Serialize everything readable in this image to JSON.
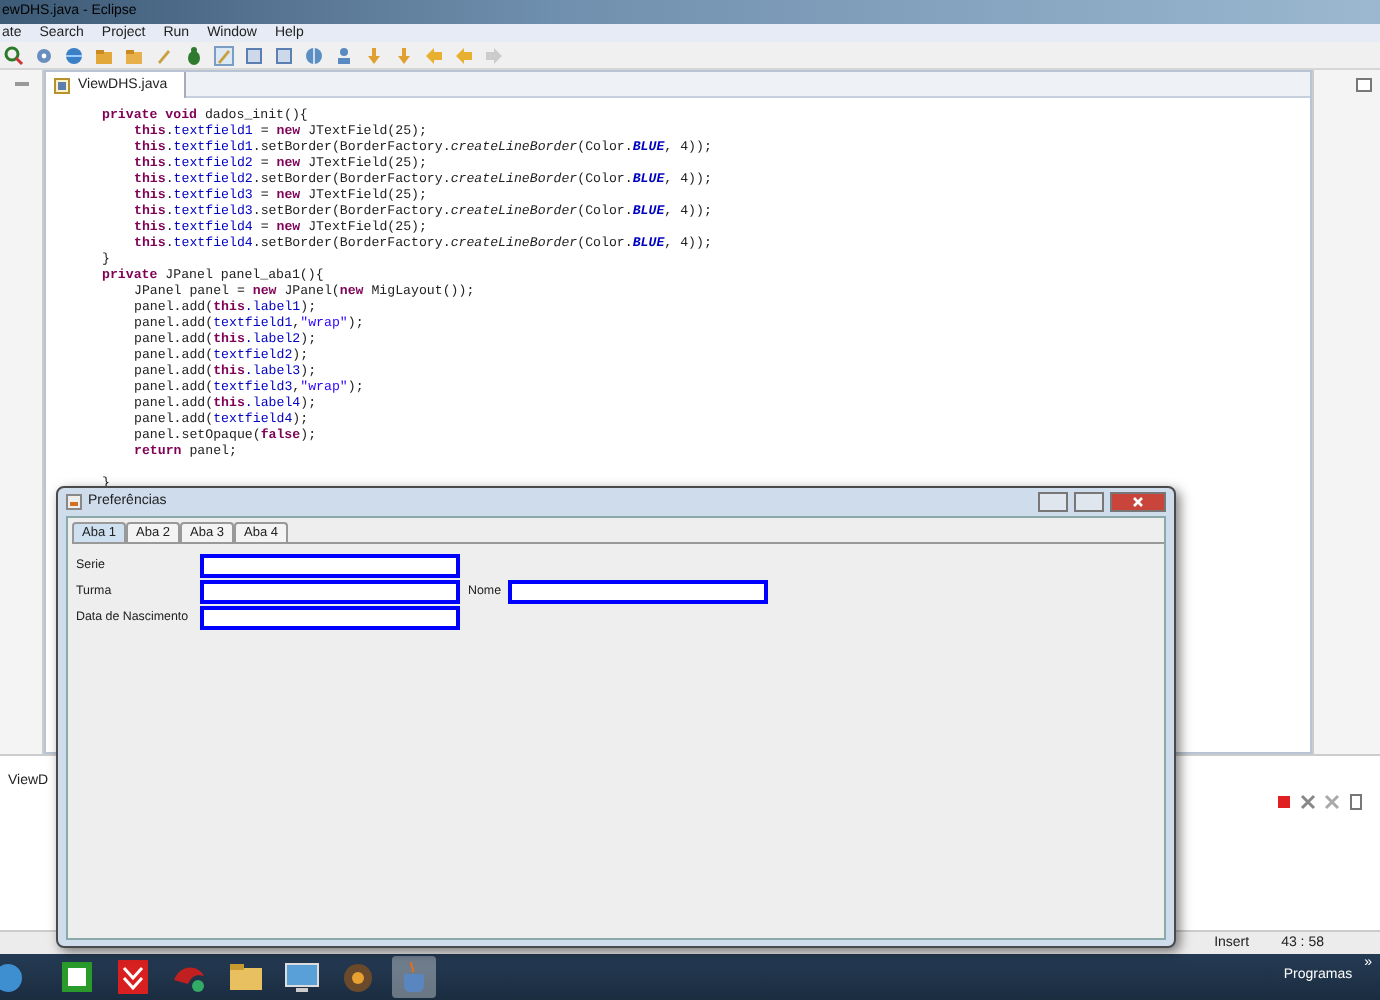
{
  "window": {
    "title": "ewDHS.java - Eclipse"
  },
  "menu": [
    "ate",
    "Search",
    "Project",
    "Run",
    "Window",
    "Help"
  ],
  "editor": {
    "tab": {
      "label": "ViewDHS.java",
      "selected": true
    },
    "lines": [
      {
        "kind": "decl",
        "tokens": [
          {
            "text": "private void",
            "kind": "keyword"
          },
          {
            "text": " dados_init(){",
            "kind": "plain"
          }
        ]
      },
      {
        "kind": "body",
        "tokens": [
          {
            "text": "this",
            "kind": "keyword"
          },
          {
            "text": ".",
            "kind": "plain"
          },
          {
            "text": "textfield1",
            "kind": "field"
          },
          {
            "text": " = ",
            "kind": "plain"
          },
          {
            "text": "new",
            "kind": "keyword"
          },
          {
            "text": " JTextField(25);",
            "kind": "plain"
          }
        ]
      },
      {
        "kind": "body",
        "tokens": [
          {
            "text": "this",
            "kind": "keyword"
          },
          {
            "text": ".",
            "kind": "plain"
          },
          {
            "text": "textfield1",
            "kind": "field"
          },
          {
            "text": ".setBorder(BorderFactory.",
            "kind": "plain"
          },
          {
            "text": "createLineBorder",
            "kind": "static"
          },
          {
            "text": "(Color.",
            "kind": "plain"
          },
          {
            "text": "BLUE",
            "kind": "constant"
          },
          {
            "text": ", 4));",
            "kind": "plain"
          }
        ]
      },
      {
        "kind": "body",
        "tokens": [
          {
            "text": "this",
            "kind": "keyword"
          },
          {
            "text": ".",
            "kind": "plain"
          },
          {
            "text": "textfield2",
            "kind": "field"
          },
          {
            "text": " = ",
            "kind": "plain"
          },
          {
            "text": "new",
            "kind": "keyword"
          },
          {
            "text": " JTextField(25);",
            "kind": "plain"
          }
        ]
      },
      {
        "kind": "body",
        "tokens": [
          {
            "text": "this",
            "kind": "keyword"
          },
          {
            "text": ".",
            "kind": "plain"
          },
          {
            "text": "textfield2",
            "kind": "field"
          },
          {
            "text": ".setBorder(BorderFactory.",
            "kind": "plain"
          },
          {
            "text": "createLineBorder",
            "kind": "static"
          },
          {
            "text": "(Color.",
            "kind": "plain"
          },
          {
            "text": "BLUE",
            "kind": "constant"
          },
          {
            "text": ", 4));",
            "kind": "plain"
          }
        ]
      },
      {
        "kind": "body",
        "tokens": [
          {
            "text": "this",
            "kind": "keyword"
          },
          {
            "text": ".",
            "kind": "plain"
          },
          {
            "text": "textfield3",
            "kind": "field"
          },
          {
            "text": " = ",
            "kind": "plain"
          },
          {
            "text": "new",
            "kind": "keyword"
          },
          {
            "text": " JTextField(25);",
            "kind": "plain"
          }
        ]
      },
      {
        "kind": "body",
        "tokens": [
          {
            "text": "this",
            "kind": "keyword"
          },
          {
            "text": ".",
            "kind": "plain"
          },
          {
            "text": "textfield3",
            "kind": "field"
          },
          {
            "text": ".setBorder(BorderFactory.",
            "kind": "plain"
          },
          {
            "text": "createLineBorder",
            "kind": "static"
          },
          {
            "text": "(Color.",
            "kind": "plain"
          },
          {
            "text": "BLUE",
            "kind": "constant"
          },
          {
            "text": ", 4));",
            "kind": "plain"
          }
        ]
      },
      {
        "kind": "body",
        "tokens": [
          {
            "text": "this",
            "kind": "keyword"
          },
          {
            "text": ".",
            "kind": "plain"
          },
          {
            "text": "textfield4",
            "kind": "field"
          },
          {
            "text": " = ",
            "kind": "plain"
          },
          {
            "text": "new",
            "kind": "keyword"
          },
          {
            "text": " JTextField(25);",
            "kind": "plain"
          }
        ]
      },
      {
        "kind": "body",
        "tokens": [
          {
            "text": "this",
            "kind": "keyword"
          },
          {
            "text": ".",
            "kind": "plain"
          },
          {
            "text": "textfield4",
            "kind": "field"
          },
          {
            "text": ".setBorder(BorderFactory.",
            "kind": "plain"
          },
          {
            "text": "createLineBorder",
            "kind": "static"
          },
          {
            "text": "(Color.",
            "kind": "plain"
          },
          {
            "text": "BLUE",
            "kind": "constant"
          },
          {
            "text": ", 4));",
            "kind": "plain"
          }
        ]
      },
      {
        "kind": "close",
        "tokens": [
          {
            "text": "}",
            "kind": "plain"
          }
        ]
      },
      {
        "kind": "decl",
        "tokens": [
          {
            "text": "private",
            "kind": "keyword"
          },
          {
            "text": " JPanel panel_aba1(){",
            "kind": "plain"
          }
        ]
      },
      {
        "kind": "body",
        "tokens": [
          {
            "text": "JPanel panel = ",
            "kind": "plain"
          },
          {
            "text": "new",
            "kind": "keyword"
          },
          {
            "text": " JPanel(",
            "kind": "plain"
          },
          {
            "text": "new",
            "kind": "keyword"
          },
          {
            "text": " MigLayout());",
            "kind": "plain"
          }
        ]
      },
      {
        "kind": "body",
        "tokens": [
          {
            "text": "panel.add(",
            "kind": "plain"
          },
          {
            "text": "this",
            "kind": "keyword"
          },
          {
            "text": ".label1",
            "kind": "field"
          },
          {
            "text": ");",
            "kind": "plain"
          }
        ]
      },
      {
        "kind": "body",
        "tokens": [
          {
            "text": "panel.add(",
            "kind": "plain"
          },
          {
            "text": "textfield1",
            "kind": "field"
          },
          {
            "text": ",",
            "kind": "plain"
          },
          {
            "text": "\"wrap\"",
            "kind": "string"
          },
          {
            "text": ");",
            "kind": "plain"
          }
        ]
      },
      {
        "kind": "body",
        "tokens": [
          {
            "text": "panel.add(",
            "kind": "plain"
          },
          {
            "text": "this",
            "kind": "keyword"
          },
          {
            "text": ".label2",
            "kind": "field"
          },
          {
            "text": ");",
            "kind": "plain"
          }
        ]
      },
      {
        "kind": "body",
        "tokens": [
          {
            "text": "panel.add(",
            "kind": "plain"
          },
          {
            "text": "textfield2",
            "kind": "field"
          },
          {
            "text": ");",
            "kind": "plain"
          }
        ]
      },
      {
        "kind": "body",
        "tokens": [
          {
            "text": "panel.add(",
            "kind": "plain"
          },
          {
            "text": "this",
            "kind": "keyword"
          },
          {
            "text": ".label3",
            "kind": "field"
          },
          {
            "text": ");",
            "kind": "plain"
          }
        ]
      },
      {
        "kind": "body",
        "tokens": [
          {
            "text": "panel.add(",
            "kind": "plain"
          },
          {
            "text": "textfield3",
            "kind": "field"
          },
          {
            "text": ",",
            "kind": "plain"
          },
          {
            "text": "\"wrap\"",
            "kind": "string"
          },
          {
            "text": ");",
            "kind": "plain"
          }
        ]
      },
      {
        "kind": "body",
        "tokens": [
          {
            "text": "panel.add(",
            "kind": "plain"
          },
          {
            "text": "this",
            "kind": "keyword"
          },
          {
            "text": ".label4",
            "kind": "field"
          },
          {
            "text": ");",
            "kind": "plain"
          }
        ]
      },
      {
        "kind": "body",
        "tokens": [
          {
            "text": "panel.add(",
            "kind": "plain"
          },
          {
            "text": "textfield4",
            "kind": "field"
          },
          {
            "text": ");",
            "kind": "plain"
          }
        ]
      },
      {
        "kind": "body",
        "tokens": [
          {
            "text": "panel.setOpaque(",
            "kind": "plain"
          },
          {
            "text": "false",
            "kind": "keyword"
          },
          {
            "text": ");",
            "kind": "plain"
          }
        ]
      },
      {
        "kind": "body",
        "tokens": [
          {
            "text": "return",
            "kind": "keyword"
          },
          {
            "text": " panel;",
            "kind": "plain"
          }
        ]
      },
      {
        "kind": "gap",
        "tokens": [
          {
            "text": "}",
            "kind": "plain"
          }
        ]
      }
    ]
  },
  "bottom_panel": {
    "tab": "ViewD"
  },
  "status_bar": {
    "insert_mode": "Insert",
    "position": "43 : 58"
  },
  "dialog": {
    "title": "Preferências",
    "tabs": [
      {
        "label": "Aba 1",
        "selected": true
      },
      {
        "label": "Aba 2",
        "selected": false
      },
      {
        "label": "Aba 3",
        "selected": false
      },
      {
        "label": "Aba 4",
        "selected": false
      }
    ],
    "rows": [
      {
        "fields": [
          {
            "label": "Serie"
          }
        ]
      },
      {
        "fields": [
          {
            "label": "Turma"
          },
          {
            "label": "Nome"
          }
        ]
      },
      {
        "fields": [
          {
            "label": "Data de Nascimento"
          }
        ]
      }
    ]
  },
  "taskbar": {
    "toolbar_label": "Programas",
    "overflow": "»"
  }
}
